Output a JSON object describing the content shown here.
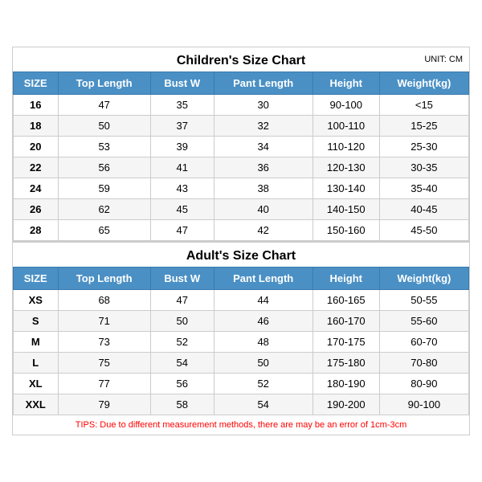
{
  "children_title": "Children's Size Chart",
  "adults_title": "Adult's Size Chart",
  "unit_label": "UNIT: CM",
  "headers": [
    "SIZE",
    "Top Length",
    "Bust W",
    "Pant Length",
    "Height",
    "Weight(kg)"
  ],
  "children_rows": [
    [
      "16",
      "47",
      "35",
      "30",
      "90-100",
      "<15"
    ],
    [
      "18",
      "50",
      "37",
      "32",
      "100-110",
      "15-25"
    ],
    [
      "20",
      "53",
      "39",
      "34",
      "110-120",
      "25-30"
    ],
    [
      "22",
      "56",
      "41",
      "36",
      "120-130",
      "30-35"
    ],
    [
      "24",
      "59",
      "43",
      "38",
      "130-140",
      "35-40"
    ],
    [
      "26",
      "62",
      "45",
      "40",
      "140-150",
      "40-45"
    ],
    [
      "28",
      "65",
      "47",
      "42",
      "150-160",
      "45-50"
    ]
  ],
  "adult_rows": [
    [
      "XS",
      "68",
      "47",
      "44",
      "160-165",
      "50-55"
    ],
    [
      "S",
      "71",
      "50",
      "46",
      "160-170",
      "55-60"
    ],
    [
      "M",
      "73",
      "52",
      "48",
      "170-175",
      "60-70"
    ],
    [
      "L",
      "75",
      "54",
      "50",
      "175-180",
      "70-80"
    ],
    [
      "XL",
      "77",
      "56",
      "52",
      "180-190",
      "80-90"
    ],
    [
      "XXL",
      "79",
      "58",
      "54",
      "190-200",
      "90-100"
    ]
  ],
  "tips": "TIPS: Due to different measurement methods, there are may be an error of 1cm-3cm"
}
